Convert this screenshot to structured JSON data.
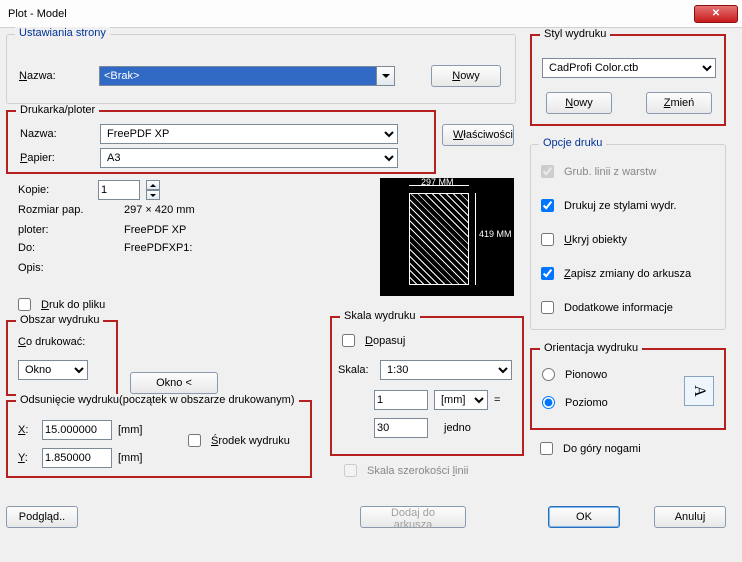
{
  "window": {
    "title": "Plot - Model"
  },
  "page_setup": {
    "legend": "Ustawiania strony",
    "name_label": "Nazwa:",
    "name_value": "<Brak>",
    "new_btn": "Nowy"
  },
  "printer": {
    "legend": "Drukarka/ploter",
    "name_label": "Nazwa:",
    "name_value": "FreePDF XP",
    "paper_label": "Papier:",
    "paper_value": "A3",
    "props_btn": "Właściwości",
    "copies_label": "Kopie:",
    "copies_value": "1",
    "size_label": "Rozmiar pap.",
    "size_value": "297 × 420  mm",
    "plotter_label": "ploter:",
    "plotter_value": "FreePDF XP",
    "to_label": "Do:",
    "to_value": "FreePDFXP1:",
    "desc_label": "Opis:",
    "tofile": "Druk do pliku",
    "preview_w": "297 MM",
    "preview_h": "419 MM"
  },
  "area": {
    "legend": "Obszar wydruku",
    "what_label": "Co drukować:",
    "what_value": "Okno",
    "window_btn": "Okno <"
  },
  "offset": {
    "legend": "Odsunięcie wydruku(początek w obszarze drukowanym)",
    "x_label": "X:",
    "x_value": "15.000000",
    "x_unit": "[mm]",
    "y_label": "Y:",
    "y_value": "1.850000",
    "y_unit": "[mm]",
    "center": "Środek wydruku"
  },
  "scale": {
    "legend": "Skala wydruku",
    "fit": "Dopasuj",
    "scale_label": "Skala:",
    "scale_value": "1:30",
    "num_value": "1",
    "unit_value": "[mm]",
    "eq": "=",
    "den_value": "30",
    "den_unit": "jedno",
    "lw": "Skala szerokości linii"
  },
  "style": {
    "legend": "Styl wydruku",
    "value": "CadProfi Color.ctb",
    "new_btn": "Nowy",
    "edit_btn": "Zmień"
  },
  "options": {
    "legend": "Opcje druku",
    "o1": "Grub. linii z warstw",
    "o2": "Drukuj ze stylami wydr.",
    "o3": "Ukryj obiekty",
    "o4": "Zapisz zmiany do arkusza",
    "o5": "Dodatkowe informacje"
  },
  "orient": {
    "legend": "Orientacja wydruku",
    "portrait": "Pionowo",
    "landscape": "Poziomo",
    "upside": "Do góry nogami",
    "glyph": "A"
  },
  "footer": {
    "preview": "Podgląd..",
    "add": "Dodaj do arkusza",
    "ok": "OK",
    "cancel": "Anuluj"
  }
}
